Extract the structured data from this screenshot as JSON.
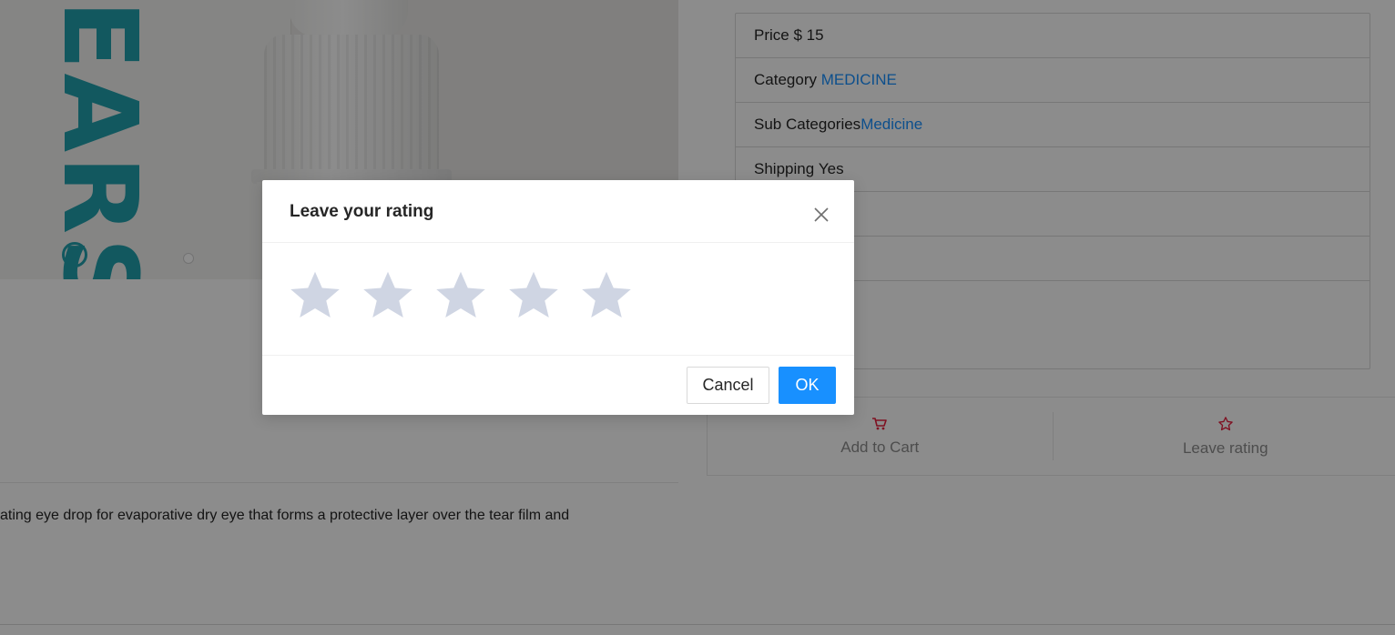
{
  "product": {
    "image": {
      "brand_text": "EARS",
      "registered_mark": "R"
    },
    "description": "ating eye drop for evaporative dry eye that forms a protective layer over the tear film and"
  },
  "details": {
    "rows": [
      {
        "label": "Price",
        "value": "$ 15",
        "linked": false
      },
      {
        "label": "Category",
        "value": "MEDICINE",
        "linked": true
      },
      {
        "label": "Sub Categories",
        "value": "Medicine",
        "linked": true
      },
      {
        "label": "Shipping",
        "value": "Yes",
        "linked": false
      },
      {
        "label": "",
        "value": "",
        "linked": false
      },
      {
        "label": "",
        "value": "",
        "linked": false
      },
      {
        "label": "",
        "value": "",
        "linked": false
      }
    ]
  },
  "actions": {
    "add_to_cart": {
      "label": "Add to Cart",
      "icon": "shopping-cart-icon"
    },
    "leave_rating": {
      "label": "Leave rating",
      "icon": "star-outline-icon"
    }
  },
  "modal": {
    "title": "Leave your rating",
    "close_icon": "close-icon",
    "stars": {
      "count": 5,
      "selected": 0,
      "empty_color": "#cfd5e3"
    },
    "cancel_label": "Cancel",
    "ok_label": "OK"
  },
  "colors": {
    "primary": "#1890ff",
    "accent_red": "#e8203f",
    "brand_teal": "#21a1ad",
    "mask": "rgba(0,0,0,0.45)"
  }
}
